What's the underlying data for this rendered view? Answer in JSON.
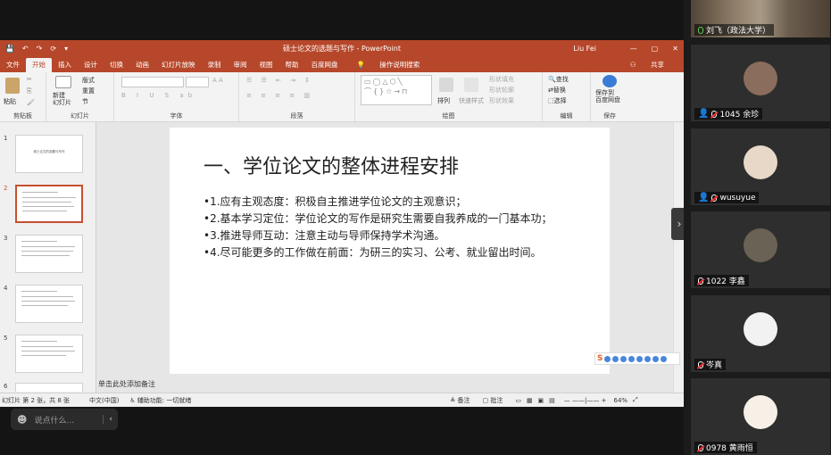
{
  "ppt": {
    "quick_access": [
      "💾",
      "↶",
      "↷",
      "⟳",
      "▾"
    ],
    "doc_title": "硕士论文的选题与写作  -  PowerPoint",
    "user": "Liu Fei",
    "tabs": [
      "文件",
      "开始",
      "插入",
      "设计",
      "切换",
      "动画",
      "幻灯片放映",
      "录制",
      "审阅",
      "视图",
      "帮助",
      "百度网盘",
      "操作说明搜索"
    ],
    "share_label": "共享",
    "ribbon": {
      "paste": "粘贴",
      "new_slide": "新建\n幻灯片",
      "layout": "版式",
      "reset": "重置",
      "section": "节",
      "groups": [
        "剪贴板",
        "幻灯片",
        "字体",
        "段落",
        "绘图",
        "编辑",
        "保存"
      ],
      "arrange": "排列",
      "quick_styles": "快速样式",
      "shape_fill": "形状填充",
      "shape_outline": "形状轮廓",
      "shape_effect": "形状效果",
      "find": "查找",
      "replace": "替换",
      "select": "选择",
      "save_baidu": "保存到\n百度网盘"
    },
    "slide_numbers": [
      "1",
      "2",
      "3",
      "4",
      "5",
      "6"
    ],
    "thumb_title": "硕士论文的选题与写作",
    "slide": {
      "title": "一、学位论文的整体进程安排",
      "bullets": [
        "•1.应有主观态度：积极自主推进学位论文的主观意识；",
        "•2.基本学习定位：学位论文的写作是研究生需要自我养成的一门基本功；",
        "•3.推进导师互动：注意主动与导师保持学术沟通。",
        "•4.尽可能更多的工作做在前面：为研三的实习、公考、就业留出时间。"
      ]
    },
    "notes_placeholder": "单击此处添加备注",
    "status": {
      "slide_pos": "幻灯片 第 2 张，共 8 张",
      "lang": "中文(中国)",
      "accessibility": "辅助功能: 一切就绪",
      "notes_btn": "备注",
      "comments_btn": "批注",
      "zoom": "64%"
    }
  },
  "chat": {
    "placeholder": "说点什么..."
  },
  "participants": [
    {
      "name": "刘飞（政法大学）",
      "type": "video"
    },
    {
      "name": "1045 余珍",
      "type": "avatar",
      "color": "#8a6d5c"
    },
    {
      "name": "wusuyue",
      "type": "avatar",
      "color": "#e8d8c8"
    },
    {
      "name": "1022 李鑫",
      "type": "avatar",
      "color": "#6a6254"
    },
    {
      "name": "岑真",
      "type": "avatar",
      "color": "#f2f2f2"
    },
    {
      "name": "0978 黄雨恒",
      "type": "avatar",
      "color": "#f7f0e6"
    }
  ]
}
